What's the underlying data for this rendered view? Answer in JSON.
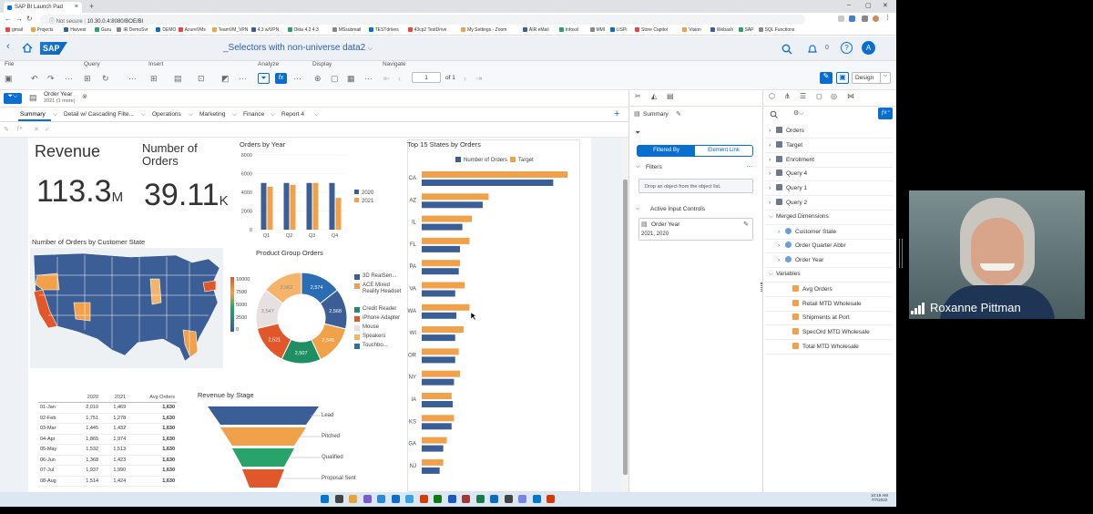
{
  "browser": {
    "tab_title": "SAP BI Launch Pad",
    "url_security": "Not secure",
    "url": "10.30.0.4:8080/BOE/BI",
    "bookmarks": [
      "gmail",
      "Projects",
      "Harvest",
      "Guru",
      "IR DemoSvr",
      "DEMO",
      "AzureVMs",
      "TeamVM_VPN",
      "4.3 w/VPN",
      "Okta 4.3 4.3",
      "MSsubmail",
      "TESTdrives",
      "43cp2 TestDrive",
      "My Settings - Zoom",
      "AIR eMail",
      "InfoxxI",
      "MMI",
      "LISPi",
      "Store Capitol",
      "Vision",
      "Webash",
      "SAP",
      "SQL Functions"
    ]
  },
  "shell": {
    "logo": "SAP",
    "doc_title": "_Selectors with non-universe data2",
    "notification_count": "0",
    "avatar_letter": "A"
  },
  "toolbar": {
    "groups": [
      "File",
      "Query",
      "Insert",
      "Analyze",
      "Display",
      "Navigate"
    ],
    "page_number": "1",
    "page_of": "of 1",
    "design_label": "Design"
  },
  "context": {
    "filter_name": "Order Year",
    "filter_value": "2021 (1 more)"
  },
  "report_tabs": [
    "Summary",
    "Detail w/ Cascading Filte...",
    "Operations",
    "Marketing",
    "Finance",
    "Report 4"
  ],
  "kpis": {
    "revenue_label": "Revenue",
    "revenue_value": "113.3",
    "revenue_unit": "M",
    "orders_label": "Number of Orders",
    "orders_value": "39.11",
    "orders_unit": "K"
  },
  "map": {
    "title": "Number of Orders by Customer State",
    "legend_ticks": [
      "10000",
      "7500",
      "5000",
      "2500",
      "0"
    ]
  },
  "funnel": {
    "title": "Revenue by Stage",
    "stages": [
      "Lead",
      "Pitched",
      "Qualified",
      "Proposal Sent"
    ],
    "colors": [
      "#3b5e96",
      "#f0a14a",
      "#28a36b",
      "#e2572a"
    ]
  },
  "table": {
    "headers": [
      "",
      "2020",
      "2021",
      "Avg Orders"
    ],
    "rows": [
      [
        "01-Jan",
        "2,010",
        "1,469",
        "1,630"
      ],
      [
        "02-Feb",
        "1,751",
        "1,278",
        "1,630"
      ],
      [
        "03-Mar",
        "1,445",
        "1,432",
        "1,630"
      ],
      [
        "04-Apr",
        "1,865",
        "1,974",
        "1,630"
      ],
      [
        "05-May",
        "1,532",
        "1,513",
        "1,630"
      ],
      [
        "06-Jun",
        "1,368",
        "1,423",
        "1,630"
      ],
      [
        "07-Jul",
        "1,937",
        "1,990",
        "1,630"
      ],
      [
        "08-Aug",
        "1,514",
        "1,424",
        "1,630"
      ]
    ]
  },
  "chart_data": [
    {
      "type": "bar",
      "title": "Orders by Year",
      "categories": [
        "Q1",
        "Q2",
        "Q3",
        "Q4"
      ],
      "series": [
        {
          "name": "2020",
          "values": [
            5000,
            5000,
            5000,
            5000
          ],
          "color": "#3b5e96"
        },
        {
          "name": "2021",
          "values": [
            4600,
            4800,
            5000,
            3400
          ],
          "color": "#f0a14a"
        }
      ],
      "ylim": [
        0,
        8000
      ],
      "yticks": [
        "8000",
        "6000",
        "4000",
        "2000",
        "0"
      ],
      "legend": "right"
    },
    {
      "type": "pie",
      "title": "Product Group Orders",
      "labels": [
        "3D RealSen...",
        "ACE Mixed Reality Headset",
        "Credit Reader",
        "iPhone Adapter",
        "Mouse",
        "Speakers",
        "Touchbo..."
      ],
      "values": [
        2568,
        2545,
        2507,
        2521,
        2547,
        2562,
        2574
      ],
      "colors": [
        "#3b5e96",
        "#f0a14a",
        "#1f8f63",
        "#e2572a",
        "#e6e0e0",
        "#f5b46a",
        "#2a6db5"
      ],
      "legend": "right"
    },
    {
      "type": "bar",
      "orientation": "horizontal",
      "title": "Top 15 States by Orders",
      "categories": [
        "CA",
        "AZ",
        "IL",
        "FL",
        "PA",
        "VA",
        "WA",
        "WI",
        "OR",
        "NY",
        "IA",
        "KS",
        "GA",
        "NJ"
      ],
      "series": [
        {
          "name": "Number of Orders",
          "color": "#3b5e96",
          "values": [
            2750,
            1275,
            850,
            800,
            775,
            700,
            725,
            700,
            700,
            675,
            650,
            625,
            450,
            375
          ]
        },
        {
          "name": "Target",
          "color": "#f0a14a",
          "values": [
            3050,
            1400,
            1050,
            1000,
            800,
            900,
            1000,
            875,
            775,
            800,
            625,
            675,
            525,
            450
          ]
        }
      ],
      "legend": "top"
    }
  ],
  "side_panel": {
    "summary_label": "Summary",
    "filtered_by": "Filtered By",
    "element_link": "Element Link",
    "filters_label": "Filters",
    "drop_hint": "Drop an object from the object list.",
    "input_controls_label": "Active Input Controls",
    "control_name": "Order Year",
    "control_value": "2021, 2020"
  },
  "objects": {
    "queries": [
      "Orders",
      "Target",
      "Enrollment",
      "Query 4",
      "Query 1",
      "Query 2"
    ],
    "merged_label": "Merged Dimensions",
    "merged": [
      "Customer State",
      "Order Quarter Abbr",
      "Order Year"
    ],
    "variables_label": "Variables",
    "variables": [
      "Avg Orders",
      "Retail MTD Wholesale",
      "Shipments at Port",
      "SpecOrd MTD Wholesale",
      "Total MTD Wholesale"
    ]
  },
  "taskbar": {
    "time": "10:19 AM",
    "date": "7/7/2022"
  },
  "video": {
    "participant": "Roxanne Pittman"
  }
}
